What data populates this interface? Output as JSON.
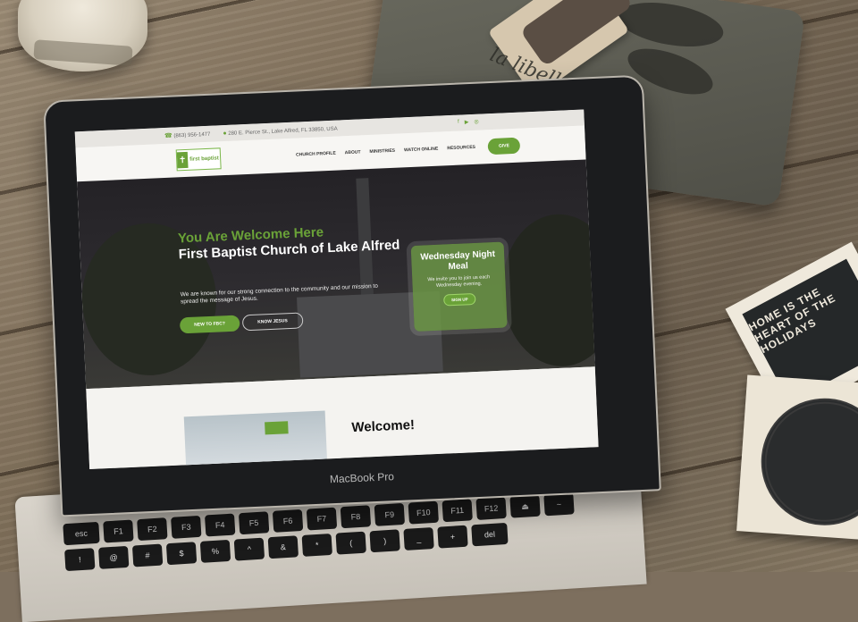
{
  "scene": {
    "pouch_text": "la libellule",
    "coaster_text": "HOME IS THE HEART OF THE HOLIDAYS",
    "laptop_brand": "MacBook Pro"
  },
  "website": {
    "topbar": {
      "phone": "(863) 956-1477",
      "address": "280 E. Pierce St., Lake Alfred, FL 33850, USA"
    },
    "logo_text": "first baptist",
    "menu": [
      "CHURCH PROFILE",
      "ABOUT",
      "MINISTRIES",
      "WATCH ONLINE",
      "RESOURCES"
    ],
    "give_label": "GIVE",
    "hero": {
      "welcome": "You Are Welcome Here",
      "title": "First Baptist Church of Lake Alfred",
      "body": "We are known for our strong connection to the community and our mission to spread the message of Jesus.",
      "btn_new": "NEW TO FBC?",
      "btn_know": "KNOW JESUS"
    },
    "card": {
      "title": "Wednesday Night Meal",
      "body": "We invite you to join us each Wednesday evening.",
      "button": "SIGN UP"
    },
    "welcome_heading": "Welcome!"
  },
  "keyboard": [
    "esc",
    "F1",
    "F2",
    "F3",
    "F4",
    "F5",
    "F6",
    "F7",
    "F8",
    "F9",
    "F10",
    "F11",
    "F12",
    "⏏",
    "~",
    "!",
    "@",
    "#",
    "$",
    "%",
    "^",
    "&",
    "*",
    "(",
    ")",
    "_",
    "+",
    "del"
  ]
}
